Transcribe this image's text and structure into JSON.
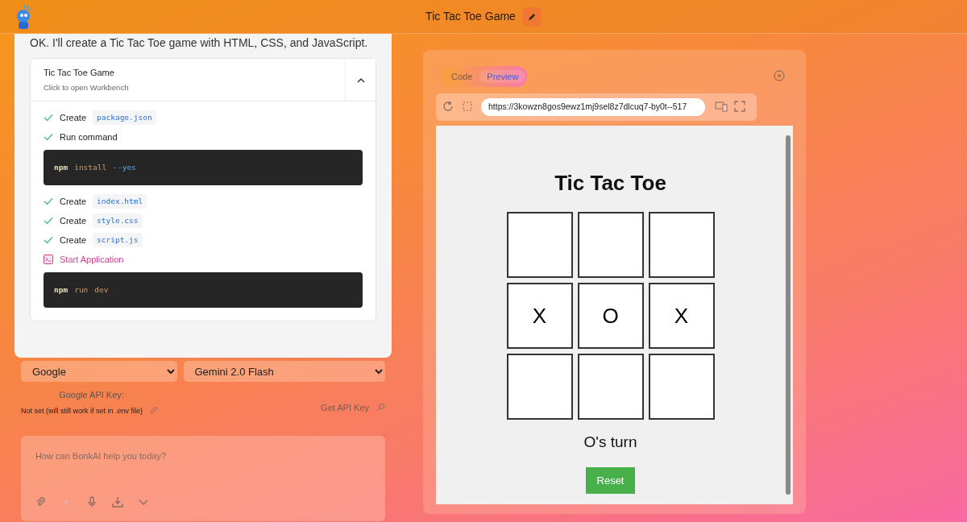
{
  "header": {
    "title": "Tic Tac Toe Game"
  },
  "chat": {
    "message": "OK. I'll create a Tic Tac Toe game with HTML, CSS, and JavaScript.",
    "artifact": {
      "title": "Tic Tac Toe Game",
      "subtitle": "Click to open Workbench",
      "expanded": true
    },
    "actions": [
      {
        "kind": "file",
        "label": "Create",
        "file": "package.json"
      },
      {
        "kind": "command",
        "label": "Run command",
        "tokens": [
          {
            "kind": "cmd",
            "text": "npm"
          },
          {
            "kind": "arg",
            "text": "install"
          },
          {
            "kind": "flag",
            "text": "--yes"
          }
        ]
      },
      {
        "kind": "file",
        "label": "Create",
        "file": "index.html"
      },
      {
        "kind": "file",
        "label": "Create",
        "file": "style.css"
      },
      {
        "kind": "file",
        "label": "Create",
        "file": "script.js"
      },
      {
        "kind": "start",
        "label": "Start Application",
        "tokens": [
          {
            "kind": "cmd",
            "text": "npm"
          },
          {
            "kind": "arg",
            "text": "run"
          },
          {
            "kind": "arg",
            "text": "dev"
          }
        ]
      }
    ]
  },
  "settings": {
    "provider": "Google",
    "model": "Gemini 2.0 Flash",
    "api_key_label": "Google API Key:",
    "api_key_status": "Not set (will still work if set in .env file)",
    "get_key": "Get API Key"
  },
  "prompt": {
    "placeholder": "How can BonkAI help you today?"
  },
  "preview": {
    "tabs": [
      {
        "label": "Code",
        "selected": false
      },
      {
        "label": "Preview",
        "selected": true
      }
    ],
    "url": "https://3kowzn8gos9ewz1mj9sel8z7dlcuq7-by0t--517",
    "game": {
      "title": "Tic Tac Toe",
      "cells": [
        {},
        {},
        {},
        {
          "mark": "X"
        },
        {
          "mark": "O"
        },
        {
          "mark": "X"
        },
        {},
        {},
        {}
      ],
      "status": "O's turn",
      "button": "Reset"
    }
  }
}
